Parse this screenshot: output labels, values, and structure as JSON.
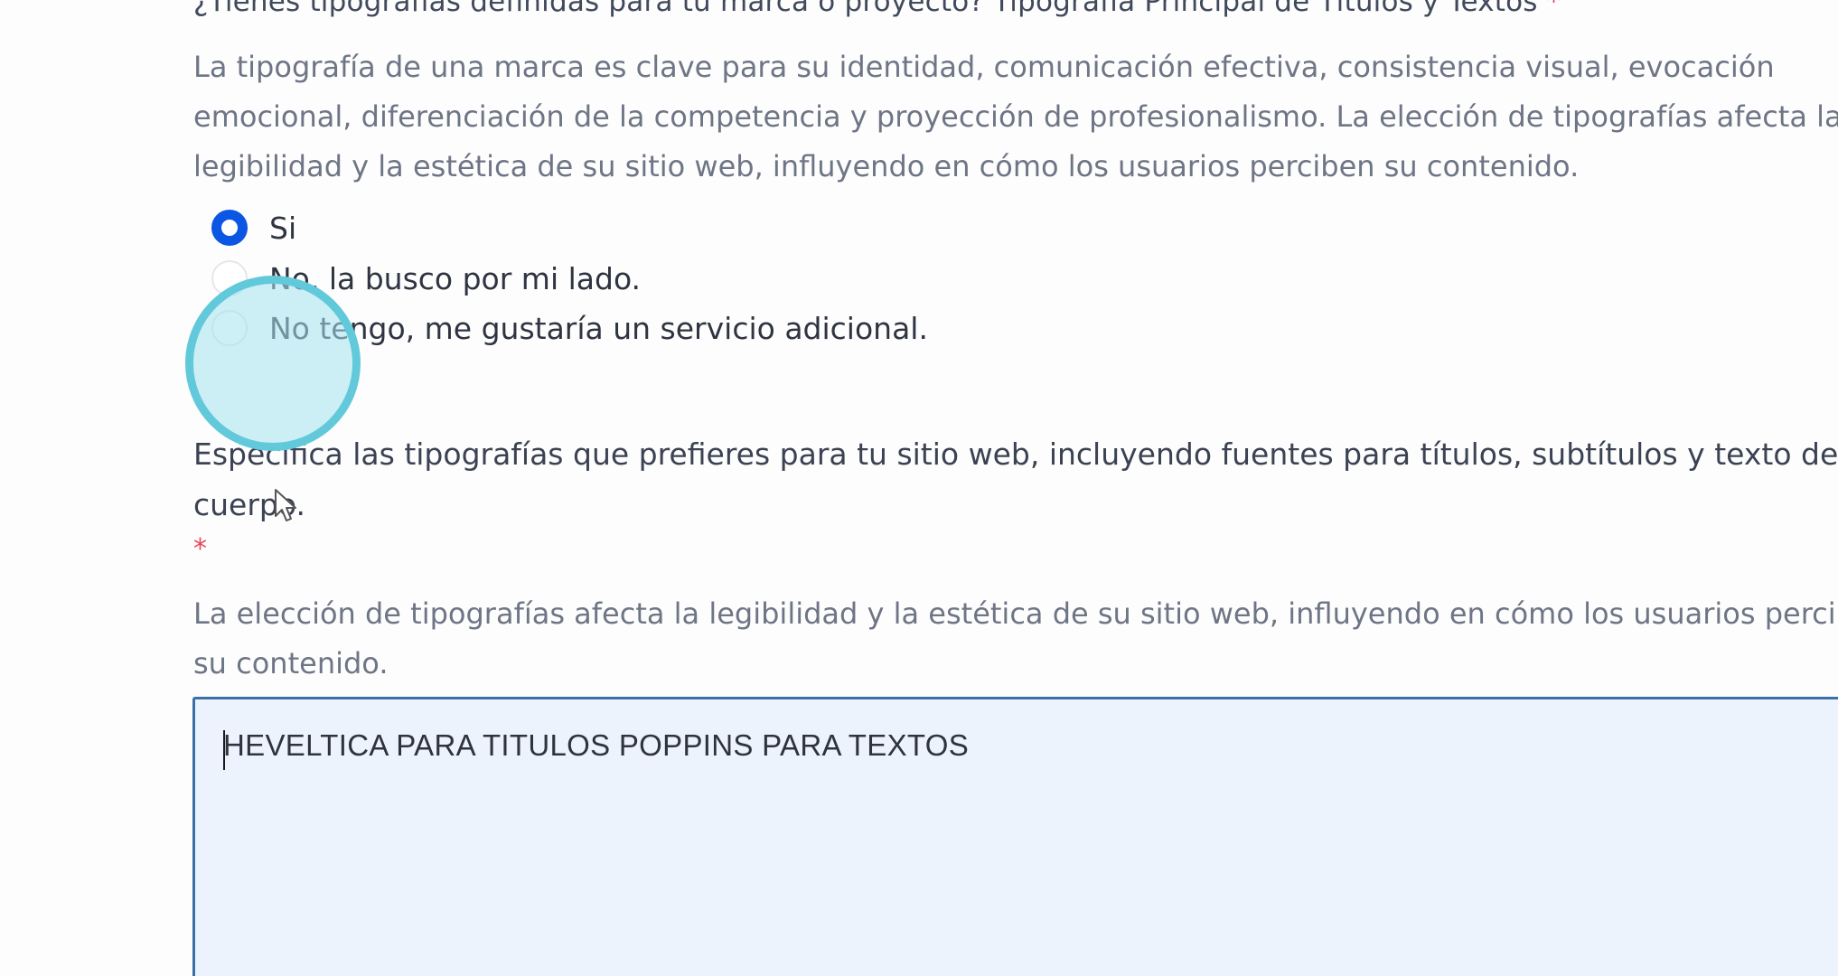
{
  "question1": {
    "label": "¿Tienes tipografías definidas para tu marca o proyecto? Tipografía Principal de Títulos y Textos",
    "required_mark": "*",
    "description_lines": [
      "La tipografía de una marca es clave para su identidad, comunicación efectiva, consistencia visual, evocación",
      "emocional, diferenciación de la competencia y proyección de profesionalismo. La elección de tipografías afecta la",
      "legibilidad y la estética de su sitio web, influyendo en cómo los usuarios perciben su contenido."
    ],
    "options": [
      {
        "label": "Si",
        "checked": true
      },
      {
        "label": "No, la busco por mi lado.",
        "checked": false
      },
      {
        "label": "No tengo, me gustaría un servicio adicional.",
        "checked": false
      }
    ]
  },
  "question2": {
    "label_lines": [
      "Especifica las tipografías que prefieres para tu sitio web, incluyendo fuentes para títulos, subtítulos y texto de",
      "cuerpo."
    ],
    "required_mark": "*",
    "description_lines": [
      "La elección de tipografías afecta la legibilidad y la estética de su sitio web, influyendo en cómo los usuarios perciben",
      "su contenido."
    ],
    "answer_value": "HEVELTICA PARA TITULOS POPPINS PARA TEXTOS"
  },
  "colors": {
    "radio_checked": "#0b57e3",
    "required": "#e8475a",
    "textarea_border": "#3b6fa8",
    "textarea_bg": "#edf3fd",
    "click_highlight": "#62c9db"
  }
}
